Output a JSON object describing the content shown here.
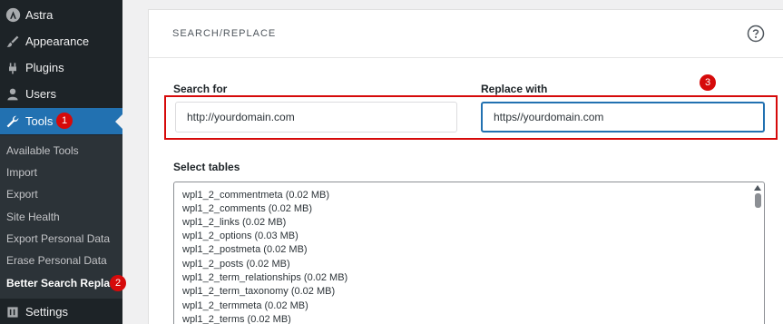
{
  "sidebar": {
    "items": [
      {
        "label": "Astra",
        "icon": "astra-logo-icon"
      },
      {
        "label": "Appearance",
        "icon": "paintbrush-icon"
      },
      {
        "label": "Plugins",
        "icon": "plugin-icon"
      },
      {
        "label": "Users",
        "icon": "user-icon"
      },
      {
        "label": "Tools",
        "icon": "wrench-icon"
      },
      {
        "label": "Settings",
        "icon": "settings-icon"
      }
    ],
    "submenu": [
      "Available Tools",
      "Import",
      "Export",
      "Site Health",
      "Export Personal Data",
      "Erase Personal Data",
      "Better Search Replace"
    ]
  },
  "annotations": {
    "step1": "1",
    "step2": "2",
    "step3": "3"
  },
  "card": {
    "title": "SEARCH/REPLACE",
    "search_label": "Search for",
    "search_value": "http://yourdomain.com",
    "replace_label": "Replace with",
    "replace_value": "https//yourdomain.com",
    "tables_label": "Select tables",
    "tables": [
      "wpl1_2_commentmeta (0.02 MB)",
      "wpl1_2_comments (0.02 MB)",
      "wpl1_2_links (0.02 MB)",
      "wpl1_2_options (0.03 MB)",
      "wpl1_2_postmeta (0.02 MB)",
      "wpl1_2_posts (0.02 MB)",
      "wpl1_2_term_relationships (0.02 MB)",
      "wpl1_2_term_taxonomy (0.02 MB)",
      "wpl1_2_termmeta (0.02 MB)",
      "wpl1_2_terms (0.02 MB)"
    ]
  },
  "colors": {
    "active": "#2271b1",
    "annotation": "#d60a0a",
    "sidebar": "#1d2327"
  }
}
